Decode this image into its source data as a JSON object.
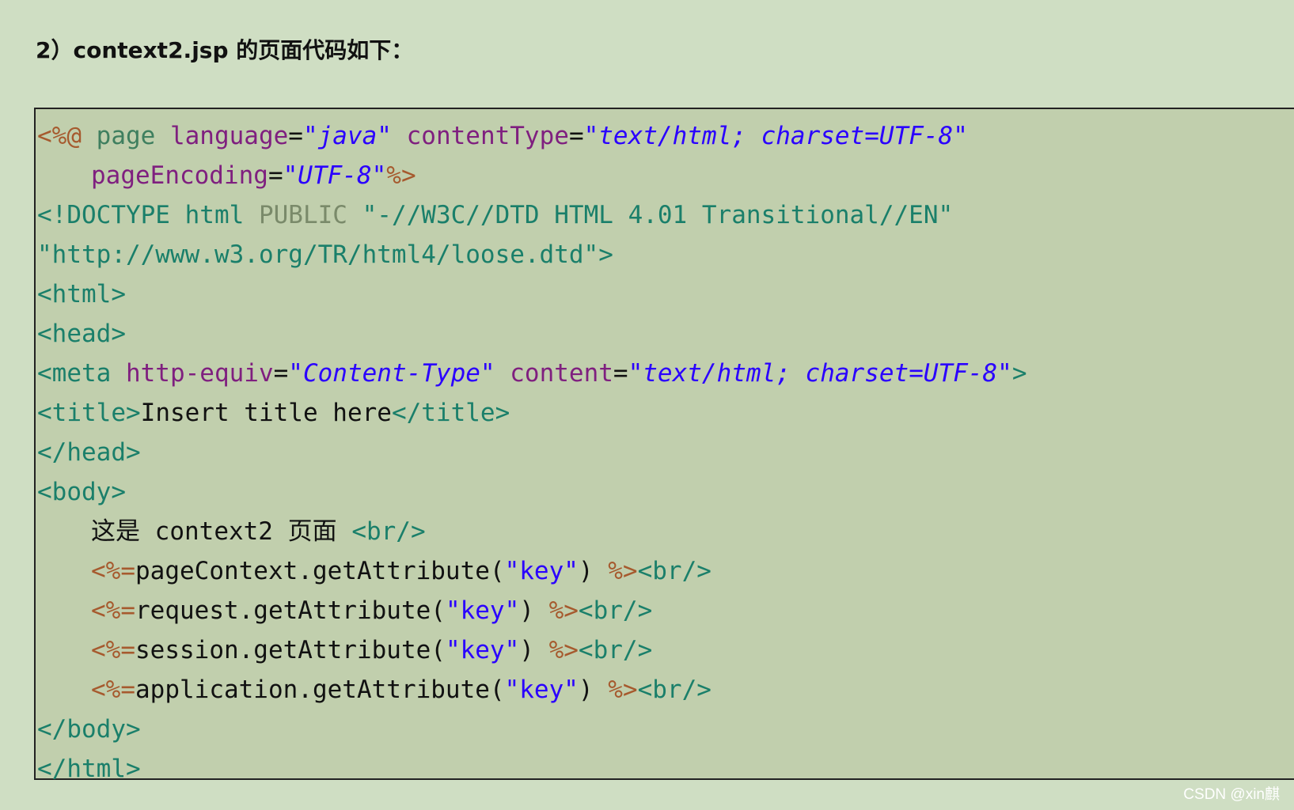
{
  "heading": "2）context2.jsp 的页面代码如下：",
  "colors": {
    "page_background": "#cfdec3",
    "code_background": "#c1cfad",
    "directive": "#a65a2e",
    "attribute": "#7f1f7f",
    "value": "#2a00ff",
    "tag": "#1a7f6a"
  },
  "code_lines": [
    {
      "indent": false,
      "tokens": [
        {
          "type": "directive",
          "text": "<%@ "
        },
        {
          "type": "kw",
          "text": "page "
        },
        {
          "type": "attr",
          "text": "language"
        },
        {
          "type": "plain",
          "text": "="
        },
        {
          "type": "val",
          "text": "\"java\""
        },
        {
          "type": "plain",
          "text": " "
        },
        {
          "type": "attr",
          "text": "contentType"
        },
        {
          "type": "plain",
          "text": "="
        },
        {
          "type": "val",
          "text": "\"text/html; charset=UTF-8\""
        }
      ]
    },
    {
      "indent": true,
      "tokens": [
        {
          "type": "attr",
          "text": "pageEncoding"
        },
        {
          "type": "plain",
          "text": "="
        },
        {
          "type": "val",
          "text": "\"UTF-8\""
        },
        {
          "type": "directive",
          "text": "%>"
        }
      ]
    },
    {
      "indent": false,
      "tokens": [
        {
          "type": "doctype",
          "text": "<!DOCTYPE html "
        },
        {
          "type": "doctype-kw",
          "text": "PUBLIC "
        },
        {
          "type": "doctype",
          "text": "\"-//W3C//DTD HTML 4.01 Transitional//EN\""
        }
      ]
    },
    {
      "indent": false,
      "tokens": [
        {
          "type": "doctype",
          "text": "\"http://www.w3.org/TR/html4/loose.dtd\">"
        }
      ]
    },
    {
      "indent": false,
      "tokens": [
        {
          "type": "tag",
          "text": "<html>"
        }
      ]
    },
    {
      "indent": false,
      "tokens": [
        {
          "type": "tag",
          "text": "<head>"
        }
      ]
    },
    {
      "indent": false,
      "tokens": [
        {
          "type": "tag",
          "text": "<meta "
        },
        {
          "type": "attr",
          "text": "http-equiv"
        },
        {
          "type": "plain",
          "text": "="
        },
        {
          "type": "val",
          "text": "\"Content-Type\""
        },
        {
          "type": "plain",
          "text": " "
        },
        {
          "type": "attr",
          "text": "content"
        },
        {
          "type": "plain",
          "text": "="
        },
        {
          "type": "val",
          "text": "\"text/html; charset=UTF-8\""
        },
        {
          "type": "tag",
          "text": ">"
        }
      ]
    },
    {
      "indent": false,
      "tokens": [
        {
          "type": "tag",
          "text": "<title>"
        },
        {
          "type": "plain",
          "text": "Insert title here"
        },
        {
          "type": "tag",
          "text": "</title>"
        }
      ]
    },
    {
      "indent": false,
      "tokens": [
        {
          "type": "tag",
          "text": "</head>"
        }
      ]
    },
    {
      "indent": false,
      "tokens": [
        {
          "type": "tag",
          "text": "<body>"
        }
      ]
    },
    {
      "indent": true,
      "tokens": [
        {
          "type": "cjk",
          "text": "这是"
        },
        {
          "type": "plain",
          "text": " context2 "
        },
        {
          "type": "cjk",
          "text": "页面"
        },
        {
          "type": "plain",
          "text": " "
        },
        {
          "type": "tag",
          "text": "<br/>"
        }
      ]
    },
    {
      "indent": true,
      "tokens": [
        {
          "type": "directive",
          "text": "<%="
        },
        {
          "type": "plain",
          "text": "pageContext.getAttribute("
        },
        {
          "type": "str",
          "text": "\"key\""
        },
        {
          "type": "plain",
          "text": ") "
        },
        {
          "type": "directive",
          "text": "%>"
        },
        {
          "type": "tag",
          "text": "<br/>"
        }
      ]
    },
    {
      "indent": true,
      "tokens": [
        {
          "type": "directive",
          "text": "<%="
        },
        {
          "type": "plain",
          "text": "request.getAttribute("
        },
        {
          "type": "str",
          "text": "\"key\""
        },
        {
          "type": "plain",
          "text": ") "
        },
        {
          "type": "directive",
          "text": "%>"
        },
        {
          "type": "tag",
          "text": "<br/>"
        }
      ]
    },
    {
      "indent": true,
      "tokens": [
        {
          "type": "directive",
          "text": "<%="
        },
        {
          "type": "plain",
          "text": "session.getAttribute("
        },
        {
          "type": "str",
          "text": "\"key\""
        },
        {
          "type": "plain",
          "text": ") "
        },
        {
          "type": "directive",
          "text": "%>"
        },
        {
          "type": "tag",
          "text": "<br/>"
        }
      ]
    },
    {
      "indent": true,
      "tokens": [
        {
          "type": "directive",
          "text": "<%="
        },
        {
          "type": "plain",
          "text": "application.getAttribute("
        },
        {
          "type": "str",
          "text": "\"key\""
        },
        {
          "type": "plain",
          "text": ") "
        },
        {
          "type": "directive",
          "text": "%>"
        },
        {
          "type": "tag",
          "text": "<br/>"
        }
      ]
    },
    {
      "indent": false,
      "tokens": [
        {
          "type": "tag",
          "text": "</body>"
        }
      ]
    },
    {
      "indent": false,
      "tokens": [
        {
          "type": "tag",
          "text": "</html>"
        }
      ]
    }
  ],
  "watermark": "CSDN @xin麒"
}
